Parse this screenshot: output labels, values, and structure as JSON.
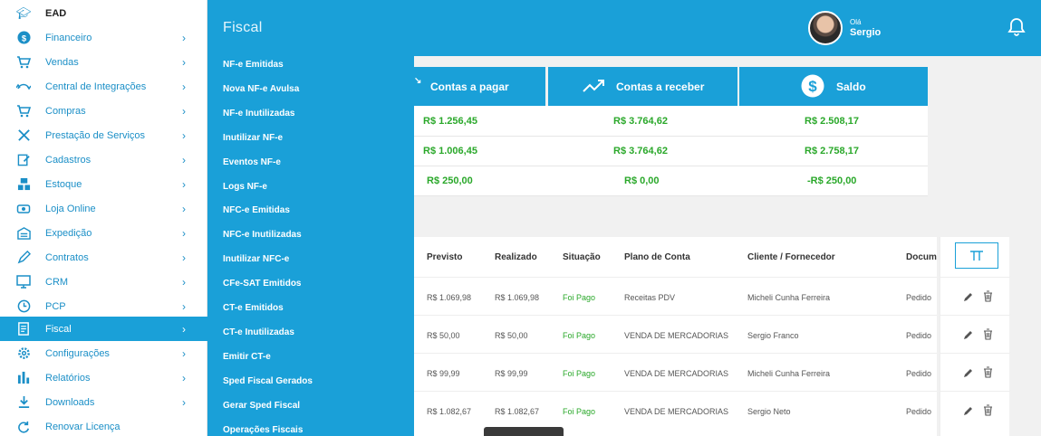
{
  "header": {
    "greeting": "Olá",
    "user_name": "Sergio"
  },
  "sidebar": {
    "items": [
      {
        "label": "EAD",
        "icon": "graduation-cap-icon"
      },
      {
        "label": "Financeiro",
        "icon": "dollar-icon"
      },
      {
        "label": "Vendas",
        "icon": "cart-icon"
      },
      {
        "label": "Central de Integrações",
        "icon": "integration-icon"
      },
      {
        "label": "Compras",
        "icon": "cart-icon"
      },
      {
        "label": "Prestação de Serviços",
        "icon": "tools-icon"
      },
      {
        "label": "Cadastros",
        "icon": "edit-icon"
      },
      {
        "label": "Estoque",
        "icon": "boxes-icon"
      },
      {
        "label": "Loja Online",
        "icon": "store-icon"
      },
      {
        "label": "Expedição",
        "icon": "warehouse-icon"
      },
      {
        "label": "Contratos",
        "icon": "pen-icon"
      },
      {
        "label": "CRM",
        "icon": "monitor-icon"
      },
      {
        "label": "PCP",
        "icon": "clock-icon"
      },
      {
        "label": "Fiscal",
        "icon": "receipt-icon"
      },
      {
        "label": "Configurações",
        "icon": "gear-icon"
      },
      {
        "label": "Relatórios",
        "icon": "bar-chart-icon"
      },
      {
        "label": "Downloads",
        "icon": "download-icon"
      },
      {
        "label": "Renovar Licença",
        "icon": "refresh-icon"
      }
    ]
  },
  "submenu": {
    "title": "Fiscal",
    "items": [
      "NF-e Emitidas",
      "Nova NF-e Avulsa",
      "NF-e Inutilizadas",
      "Inutilizar NF-e",
      "Eventos NF-e",
      "Logs NF-e",
      "NFC-e Emitidas",
      "NFC-e Inutilizadas",
      "Inutilizar NFC-e",
      "CFe-SAT Emitidos",
      "CT-e Emitidos",
      "CT-e Inutilizadas",
      "Emitir CT-e",
      "Sped Fiscal Gerados",
      "Gerar Sped Fiscal",
      "Operações Fiscais"
    ]
  },
  "cards": {
    "pagar": "Contas a pagar",
    "receber": "Contas a receber",
    "saldo": "Saldo"
  },
  "summary": {
    "rows": [
      [
        "R$ 1.256,45",
        "R$ 3.764,62",
        "R$ 2.508,17"
      ],
      [
        "R$ 1.006,45",
        "R$ 3.764,62",
        "R$ 2.758,17"
      ],
      [
        "R$ 250,00",
        "R$ 0,00",
        "-R$ 250,00"
      ]
    ]
  },
  "table": {
    "headers": [
      "Previsto",
      "Realizado",
      "Situação",
      "Plano de Conta",
      "Cliente / Fornecedor",
      "Docum"
    ],
    "rows": [
      [
        "R$ 1.069,98",
        "R$ 1.069,98",
        "Foi Pago",
        "Receitas PDV",
        "Micheli Cunha Ferreira",
        "Pedido"
      ],
      [
        "R$ 50,00",
        "R$ 50,00",
        "Foi Pago",
        "VENDA DE MERCADORIAS",
        "Sergio Franco",
        "Pedido"
      ],
      [
        "R$ 99,99",
        "R$ 99,99",
        "Foi Pago",
        "VENDA DE MERCADORIAS",
        "Micheli Cunha Ferreira",
        "Pedido"
      ],
      [
        "R$ 1.082,67",
        "R$ 1.082,67",
        "Foi Pago",
        "VENDA DE MERCADORIAS",
        "Sergio Neto",
        "Pedido"
      ]
    ]
  },
  "colors": {
    "primary": "#1aa0d8",
    "positive": "#2aa82a"
  }
}
